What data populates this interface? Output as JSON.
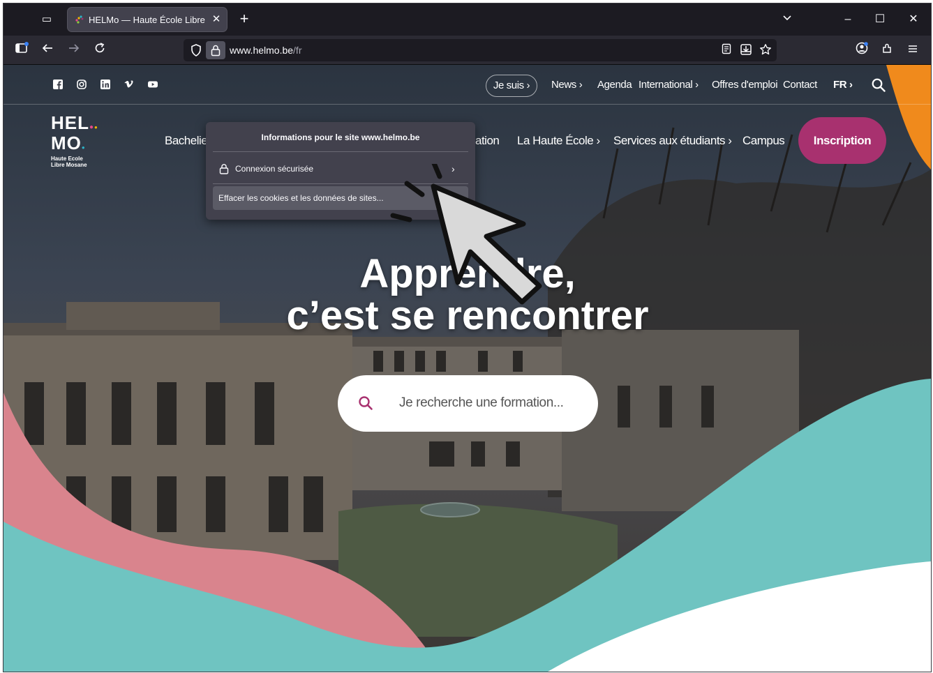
{
  "browser": {
    "tab": {
      "title": "HELMo — Haute École Libre Mc",
      "close": "✕"
    },
    "new_tab": "+",
    "window_controls": {
      "minimize": "–",
      "maximize": "☐",
      "close": "✕"
    },
    "url": {
      "host": "www.helmo.be",
      "path": "/fr"
    }
  },
  "site_info_popup": {
    "title": "Informations pour le site www.helmo.be",
    "secure_connection": "Connexion sécurisée",
    "clear_cookies": "Effacer les cookies et les données de sites..."
  },
  "site": {
    "top_nav": {
      "je_suis": "Je suis",
      "links": [
        "News",
        "Agenda",
        "International",
        "Offres d'emploi",
        "Contact"
      ],
      "lang": "FR"
    },
    "logo": {
      "line1": "HEL",
      "line2": "MO",
      "sub1": "Haute Ecole",
      "sub2": "Libre Mosane"
    },
    "main_nav": {
      "bacheliers": "Bacheliers",
      "formation_partial": "ation",
      "haute_ecole": "La Haute École",
      "services": "Services aux étudiants",
      "campus": "Campus",
      "inscription": "Inscription"
    },
    "hero": {
      "title_line1": "Apprendre,",
      "title_line2": "c’est se rencontrer",
      "search_placeholder": "Je recherche une formation..."
    }
  },
  "colors": {
    "brand_magenta": "#a8316f",
    "wave_pink": "#d9848d",
    "wave_teal": "#6fc4c1",
    "accent_orange": "#f08a1c"
  }
}
